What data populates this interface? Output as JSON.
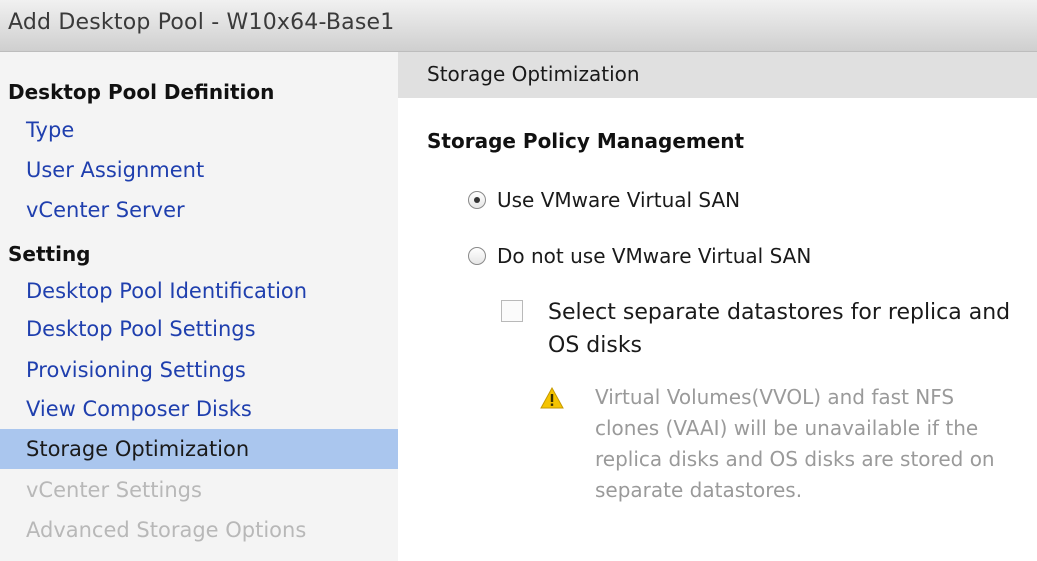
{
  "window": {
    "title": "Add Desktop Pool - W10x64-Base1"
  },
  "sidebar": {
    "group1_title": "Desktop Pool Definition",
    "group1_items": [
      "Type",
      "User Assignment",
      "vCenter Server"
    ],
    "group2_title": "Setting",
    "group2_items": [
      "Desktop Pool Identification",
      "Desktop Pool Settings",
      "Provisioning Settings",
      "View Composer Disks"
    ],
    "active_item": "Storage Optimization",
    "disabled_items": [
      "vCenter Settings",
      "Advanced Storage Options"
    ]
  },
  "main": {
    "section_title": "Storage Optimization",
    "heading": "Storage Policy Management",
    "radio_options": [
      {
        "label": "Use VMware Virtual SAN",
        "selected": true
      },
      {
        "label": "Do not use VMware Virtual SAN",
        "selected": false
      }
    ],
    "checkbox": {
      "label": "Select separate datastores for replica and OS disks",
      "checked": false
    },
    "warning": {
      "icon": "warning-icon",
      "text": "Virtual Volumes(VVOL) and fast NFS clones (VAAI) will be unavailable if the replica disks and OS disks are stored on separate datastores."
    },
    "colors": {
      "active_nav_bg": "#aac6ee",
      "link": "#1f3fae",
      "disabled": "#b8b8b8",
      "warning_yellow": "#f5c400"
    }
  }
}
